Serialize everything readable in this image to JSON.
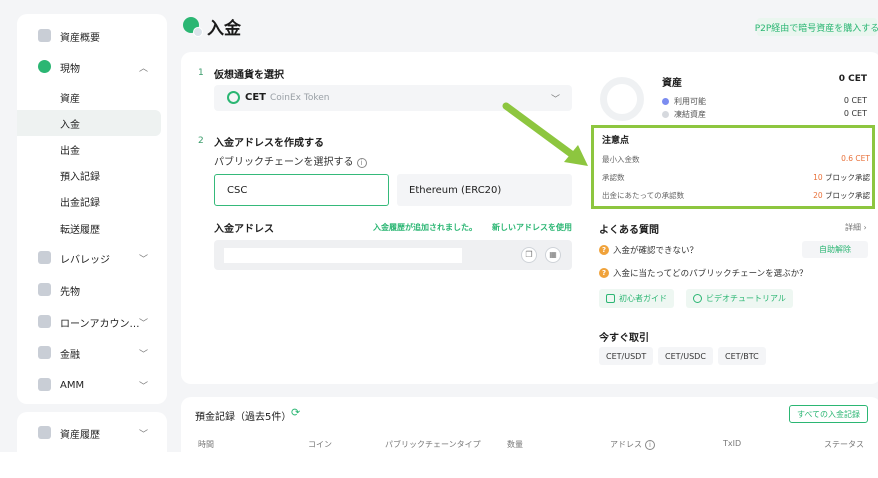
{
  "sidebar": {
    "overview": "資産概要",
    "spot": "現物",
    "spot_items": [
      "資産",
      "入金",
      "出金",
      "預入記録",
      "出金記録",
      "転送履歴"
    ],
    "leverage": "レバレッジ",
    "futures": "先物",
    "loan": "ローンアカウン…",
    "finance": "金融",
    "amm": "AMM",
    "history": "資産履歴"
  },
  "header": {
    "title": "入金",
    "p2p_link": "P2P経由で暗号資産を購入する"
  },
  "step1": {
    "num": "1",
    "title": "仮想通貨を選択",
    "coin_symbol": "CET",
    "coin_name": "CoinEx Token"
  },
  "step2": {
    "num": "2",
    "title": "入金アドレスを作成する",
    "chain_label": "パブリックチェーンを選択する",
    "chain_selected": "CSC",
    "chain_alt": "Ethereum (ERC20)",
    "address_label": "入金アドレス",
    "address_note": "入金履歴が追加されました。",
    "new_address": "新しいアドレスを使用"
  },
  "assets": {
    "title": "資産",
    "total": "0 CET",
    "available_label": "利用可能",
    "available_value": "0 CET",
    "frozen_label": "凍結資産",
    "frozen_value": "0 CET",
    "available_color": "#7b8cf0",
    "frozen_color": "#d6d9de"
  },
  "notice": {
    "title": "注意点",
    "min_label": "最小入金数",
    "min_value": "0.6 CET",
    "confirm_label": "承認数",
    "confirm_num": "10",
    "confirm_unit": " ブロック承認",
    "withdraw_label": "出金にあたっての承認数",
    "withdraw_num": "20",
    "withdraw_unit": " ブロック承認"
  },
  "faq": {
    "title": "よくある質問",
    "more": "詳細 ›",
    "q1": "入金が確認できない？",
    "q2": "入金に当たってどのパブリックチェーンを選ぶか？",
    "self_service": "自助解除",
    "guide": "初心者ガイド",
    "video": "ビデオチュートリアル"
  },
  "trade": {
    "title": "今すぐ取引",
    "pairs": [
      "CET/USDT",
      "CET/USDC",
      "CET/BTC"
    ]
  },
  "history": {
    "title": "預金記録（過去5件）",
    "all_button": "すべての入金記録",
    "columns": [
      "時間",
      "コイン",
      "パブリックチェーンタイプ",
      "数量",
      "アドレス",
      "TxID",
      "ステータス"
    ]
  },
  "annotation_color": "#8dc63f"
}
